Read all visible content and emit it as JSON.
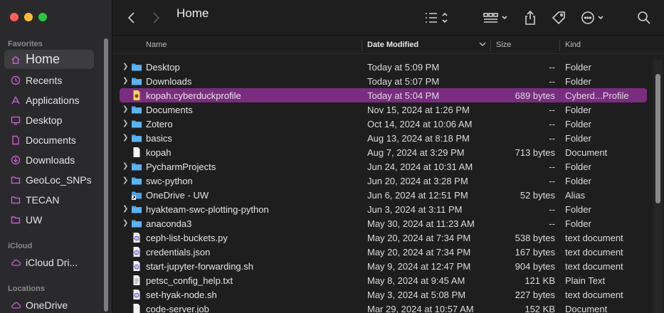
{
  "window": {
    "title": "Home"
  },
  "sidebar": {
    "sections": [
      {
        "label": "Favorites"
      },
      {
        "label": "iCloud"
      },
      {
        "label": "Locations"
      }
    ],
    "items": [
      {
        "label": "Home",
        "icon": "home-icon"
      },
      {
        "label": "Recents",
        "icon": "clock-icon"
      },
      {
        "label": "Applications",
        "icon": "applications-icon"
      },
      {
        "label": "Desktop",
        "icon": "desktop-icon"
      },
      {
        "label": "Documents",
        "icon": "document-icon"
      },
      {
        "label": "Downloads",
        "icon": "download-icon"
      },
      {
        "label": "GeoLoc_SNPs",
        "icon": "folder-icon"
      },
      {
        "label": "TECAN",
        "icon": "folder-icon"
      },
      {
        "label": "UW",
        "icon": "folder-icon"
      },
      {
        "label": "iCloud Dri...",
        "icon": "cloud-icon"
      },
      {
        "label": "OneDrive",
        "icon": "cloud-icon"
      }
    ]
  },
  "columns": {
    "name": "Name",
    "date": "Date Modified",
    "size": "Size",
    "kind": "Kind"
  },
  "files": [
    {
      "name": "Desktop",
      "date": "Today at 5:09 PM",
      "size": "--",
      "kind": "Folder",
      "type": "folder"
    },
    {
      "name": "Downloads",
      "date": "Today at 5:07 PM",
      "size": "--",
      "kind": "Folder",
      "type": "folder"
    },
    {
      "name": "kopah.cyberduckprofile",
      "date": "Today at 5:04 PM",
      "size": "689 bytes",
      "kind": "Cyberd...Profile",
      "type": "profile"
    },
    {
      "name": "Documents",
      "date": "Nov 15, 2024 at 1:26 PM",
      "size": "--",
      "kind": "Folder",
      "type": "folder"
    },
    {
      "name": "Zotero",
      "date": "Oct 14, 2024 at 10:06 AM",
      "size": "--",
      "kind": "Folder",
      "type": "folder"
    },
    {
      "name": "basics",
      "date": "Aug 13, 2024 at 8:18 PM",
      "size": "--",
      "kind": "Folder",
      "type": "folder"
    },
    {
      "name": "kopah",
      "date": "Aug 7, 2024 at 3:29 PM",
      "size": "713 bytes",
      "kind": "Document",
      "type": "doc"
    },
    {
      "name": "PycharmProjects",
      "date": "Jun 24, 2024 at 10:31 AM",
      "size": "--",
      "kind": "Folder",
      "type": "folder"
    },
    {
      "name": "swc-python",
      "date": "Jun 20, 2024 at 3:28 PM",
      "size": "--",
      "kind": "Folder",
      "type": "folder"
    },
    {
      "name": "OneDrive - UW",
      "date": "Jun 6, 2024 at 12:51 PM",
      "size": "52 bytes",
      "kind": "Alias",
      "type": "alias"
    },
    {
      "name": "hyakteam-swc-plotting-python",
      "date": "Jun 3, 2024 at 3:11 PM",
      "size": "--",
      "kind": "Folder",
      "type": "folder"
    },
    {
      "name": "anaconda3",
      "date": "May 30, 2024 at 11:23 AM",
      "size": "--",
      "kind": "Folder",
      "type": "folder"
    },
    {
      "name": "ceph-list-buckets.py",
      "date": "May 20, 2024 at 7:34 PM",
      "size": "538 bytes",
      "kind": "text document",
      "type": "text"
    },
    {
      "name": "credentials.json",
      "date": "May 20, 2024 at 7:34 PM",
      "size": "167 bytes",
      "kind": "text document",
      "type": "text"
    },
    {
      "name": "start-jupyter-forwarding.sh",
      "date": "May 9, 2024 at 12:47 PM",
      "size": "904 bytes",
      "kind": "text document",
      "type": "text"
    },
    {
      "name": "petsc_config_help.txt",
      "date": "May 8, 2024 at 9:45 AM",
      "size": "121 KB",
      "kind": "Plain Text",
      "type": "plain"
    },
    {
      "name": "set-hyak-node.sh",
      "date": "May 3, 2024 at 5:08 PM",
      "size": "227 bytes",
      "kind": "text document",
      "type": "text"
    },
    {
      "name": "code-server.job",
      "date": "Mar 29, 2024 at 10:57 AM",
      "size": "152 KB",
      "kind": "Document",
      "type": "doc"
    }
  ],
  "colors": {
    "accent": "#c65bd0",
    "selection": "#7a2d80",
    "folder": "#4aa3e8"
  }
}
